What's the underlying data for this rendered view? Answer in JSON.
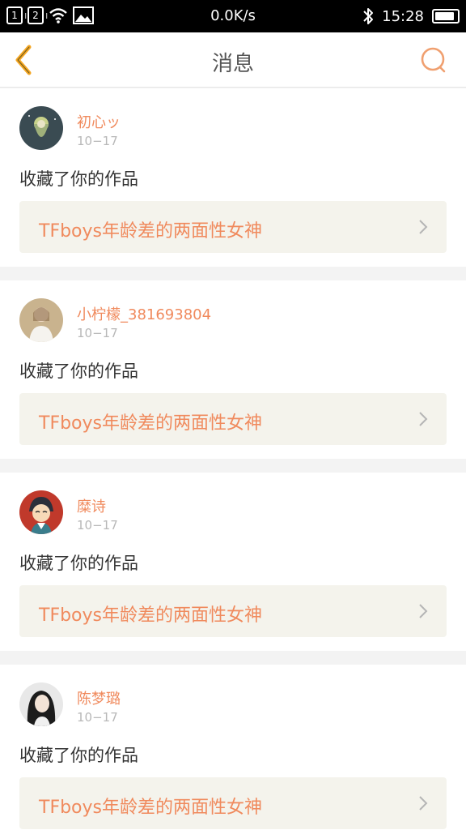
{
  "status_bar": {
    "sim1": "1",
    "sim2": "2",
    "network_speed": "0.0K/s",
    "time": "15:28",
    "battery_level": 0.9
  },
  "nav": {
    "title": "消息",
    "back_icon": "chevron-left-icon",
    "search_icon": "search-icon",
    "accent_color": "#f5a623"
  },
  "messages": [
    {
      "username": "初心ッ",
      "date": "10−17",
      "action": "收藏了你的作品",
      "work_title": "TFboys年龄差的两面性女神",
      "avatar_color": "#3a4b52"
    },
    {
      "username": "小柠檬_381693804",
      "date": "10−17",
      "action": "收藏了你的作品",
      "work_title": "TFboys年龄差的两面性女神",
      "avatar_color": "#c9b38e"
    },
    {
      "username": "糜诗",
      "date": "10−17",
      "action": "收藏了你的作品",
      "work_title": "TFboys年龄差的两面性女神",
      "avatar_color": "#c0392b"
    },
    {
      "username": "陈梦璐",
      "date": "10−17",
      "action": "收藏了你的作品",
      "work_title": "TFboys年龄差的两面性女神",
      "avatar_color": "#e8e8e8"
    }
  ]
}
